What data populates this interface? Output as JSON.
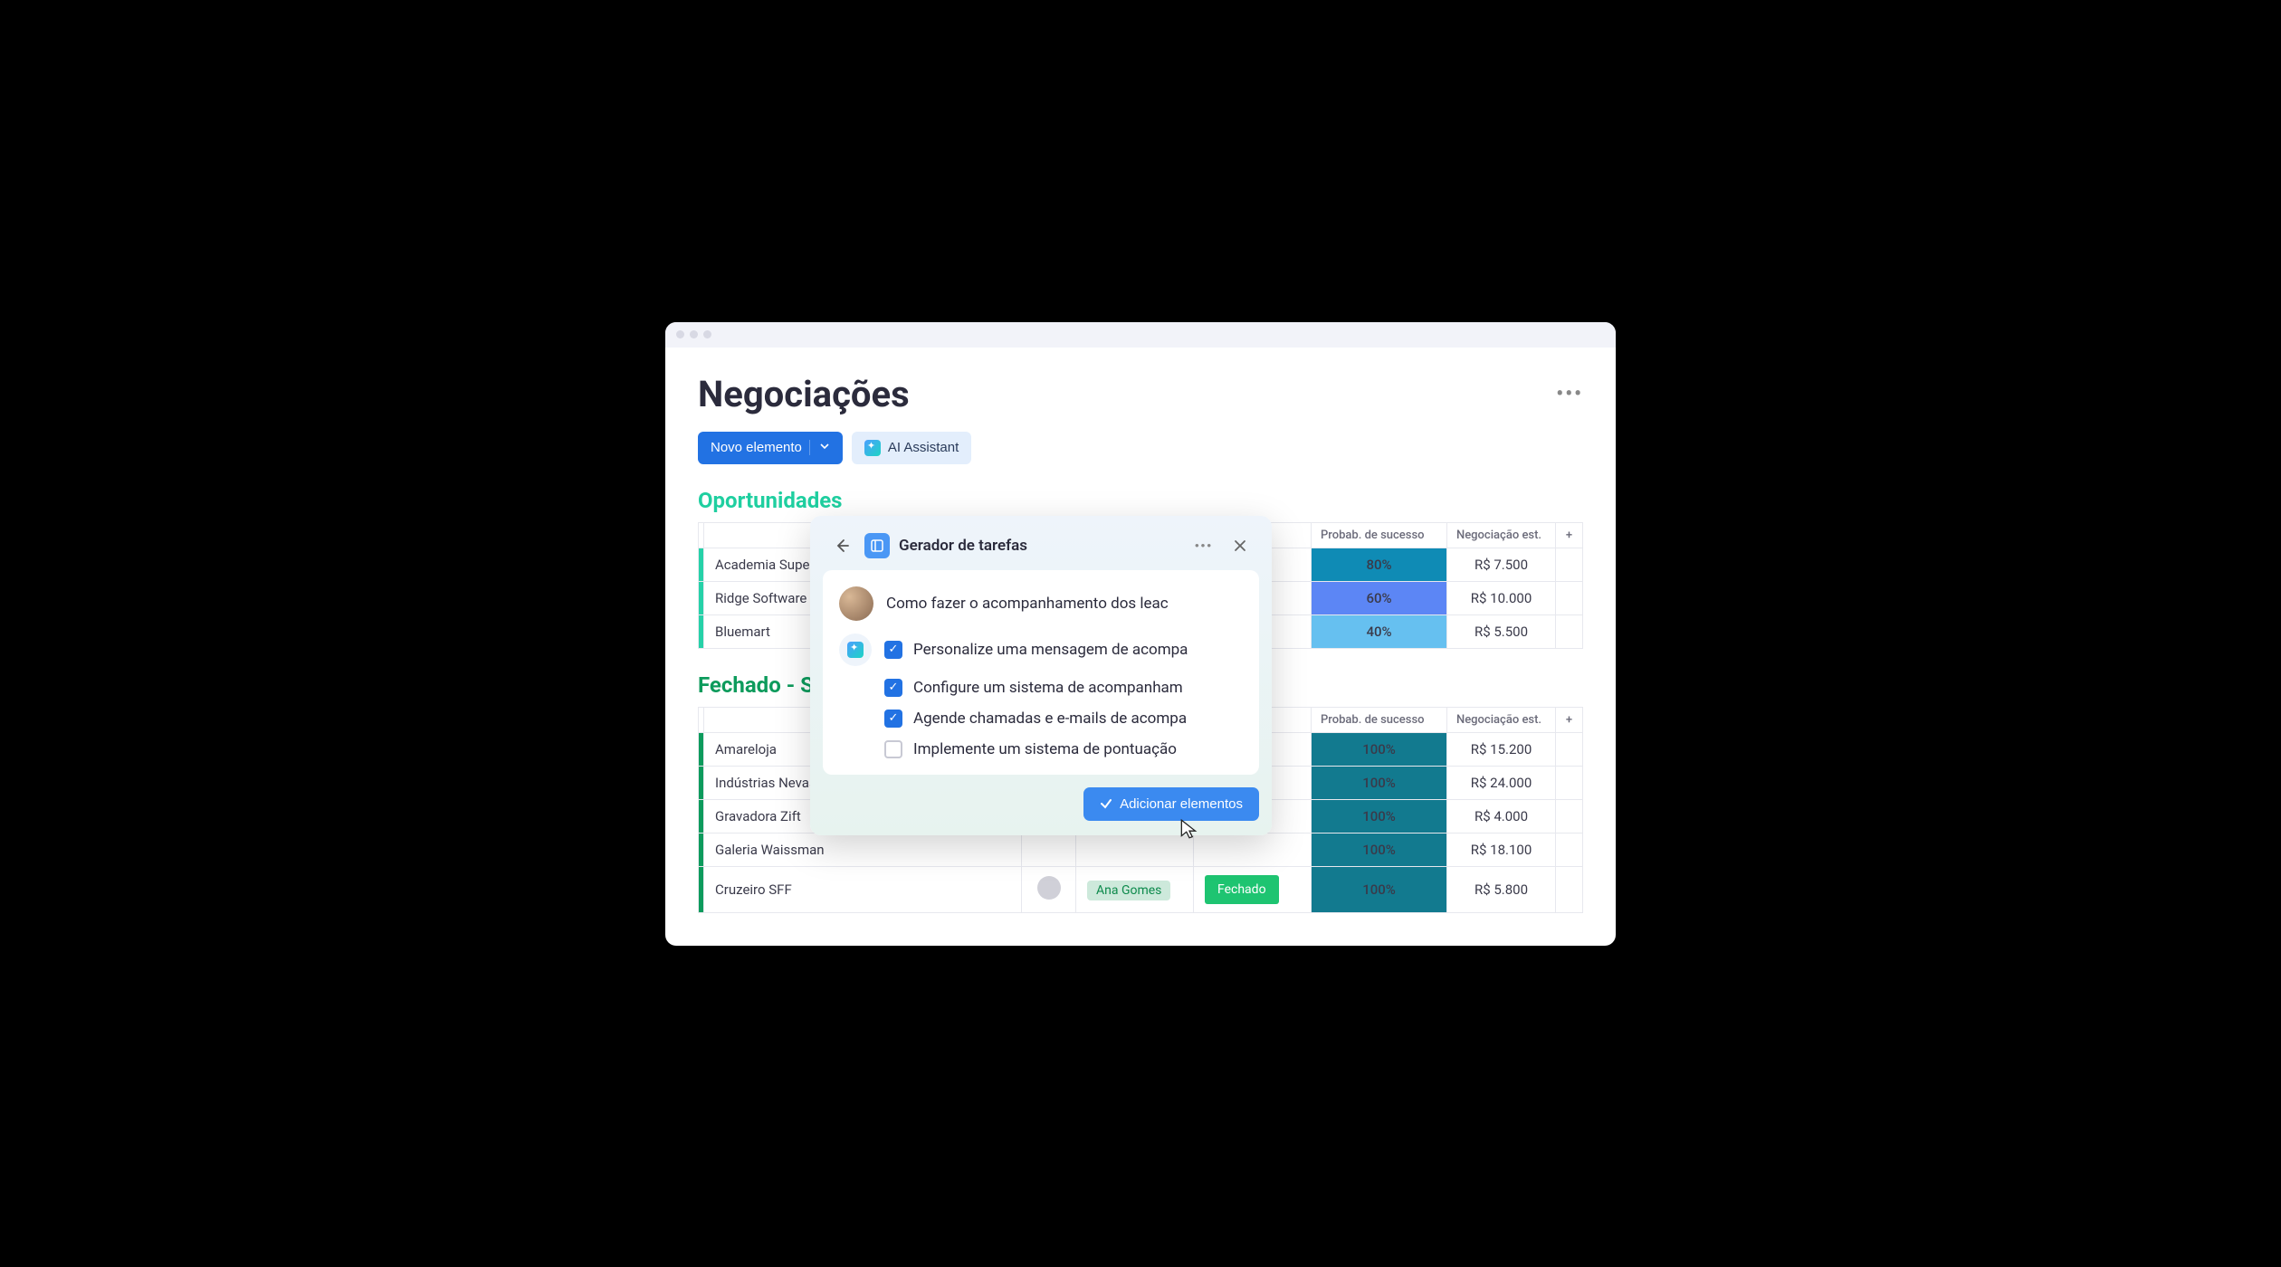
{
  "page": {
    "title": "Negociações"
  },
  "toolbar": {
    "new_element": "Novo elemento",
    "ai_assistant": "AI Assistant"
  },
  "columns": {
    "probability": "Probab. de sucesso",
    "negotiation": "Negociação est."
  },
  "sections": [
    {
      "id": "oportunidades",
      "title": "Oportunidades",
      "accent": "green1",
      "rows": [
        {
          "name": "Academia Super Ri",
          "probability": "80%",
          "prob_class": "p80",
          "negotiation": "R$ 7.500"
        },
        {
          "name": "Ridge Software",
          "probability": "60%",
          "prob_class": "p60",
          "negotiation": "R$ 10.000"
        },
        {
          "name": "Bluemart",
          "probability": "40%",
          "prob_class": "p40",
          "negotiation": "R$ 5.500"
        }
      ]
    },
    {
      "id": "fechado",
      "title": "Fechado - Su",
      "accent": "green2",
      "rows": [
        {
          "name": "Amareloja",
          "probability": "100%",
          "prob_class": "p100",
          "negotiation": "R$ 15.200"
        },
        {
          "name": "Indústrias Nevasca",
          "probability": "100%",
          "prob_class": "p100",
          "negotiation": "R$ 24.000"
        },
        {
          "name": "Gravadora Zift",
          "probability": "100%",
          "prob_class": "p100",
          "negotiation": "R$ 4.000"
        },
        {
          "name": "Galeria Waissman",
          "probability": "100%",
          "prob_class": "p100",
          "negotiation": "R$ 18.100"
        },
        {
          "name": "Cruzeiro SFF",
          "owner_label": "Ana Gomes",
          "status_label": "Fechado",
          "probability": "100%",
          "prob_class": "p100",
          "negotiation": "R$ 5.800"
        }
      ]
    }
  ],
  "modal": {
    "title": "Gerador de tarefas",
    "prompt": "Como fazer o acompanhamento dos leac",
    "tasks": [
      {
        "label": "Personalize uma mensagem de acompa",
        "checked": true
      },
      {
        "label": "Configure um sistema de acompanham",
        "checked": true
      },
      {
        "label": "Agende chamadas e e-mails de acompa",
        "checked": true
      },
      {
        "label": "Implemente um sistema de pontuação",
        "checked": false
      }
    ],
    "add_button": "Adicionar elementos"
  }
}
